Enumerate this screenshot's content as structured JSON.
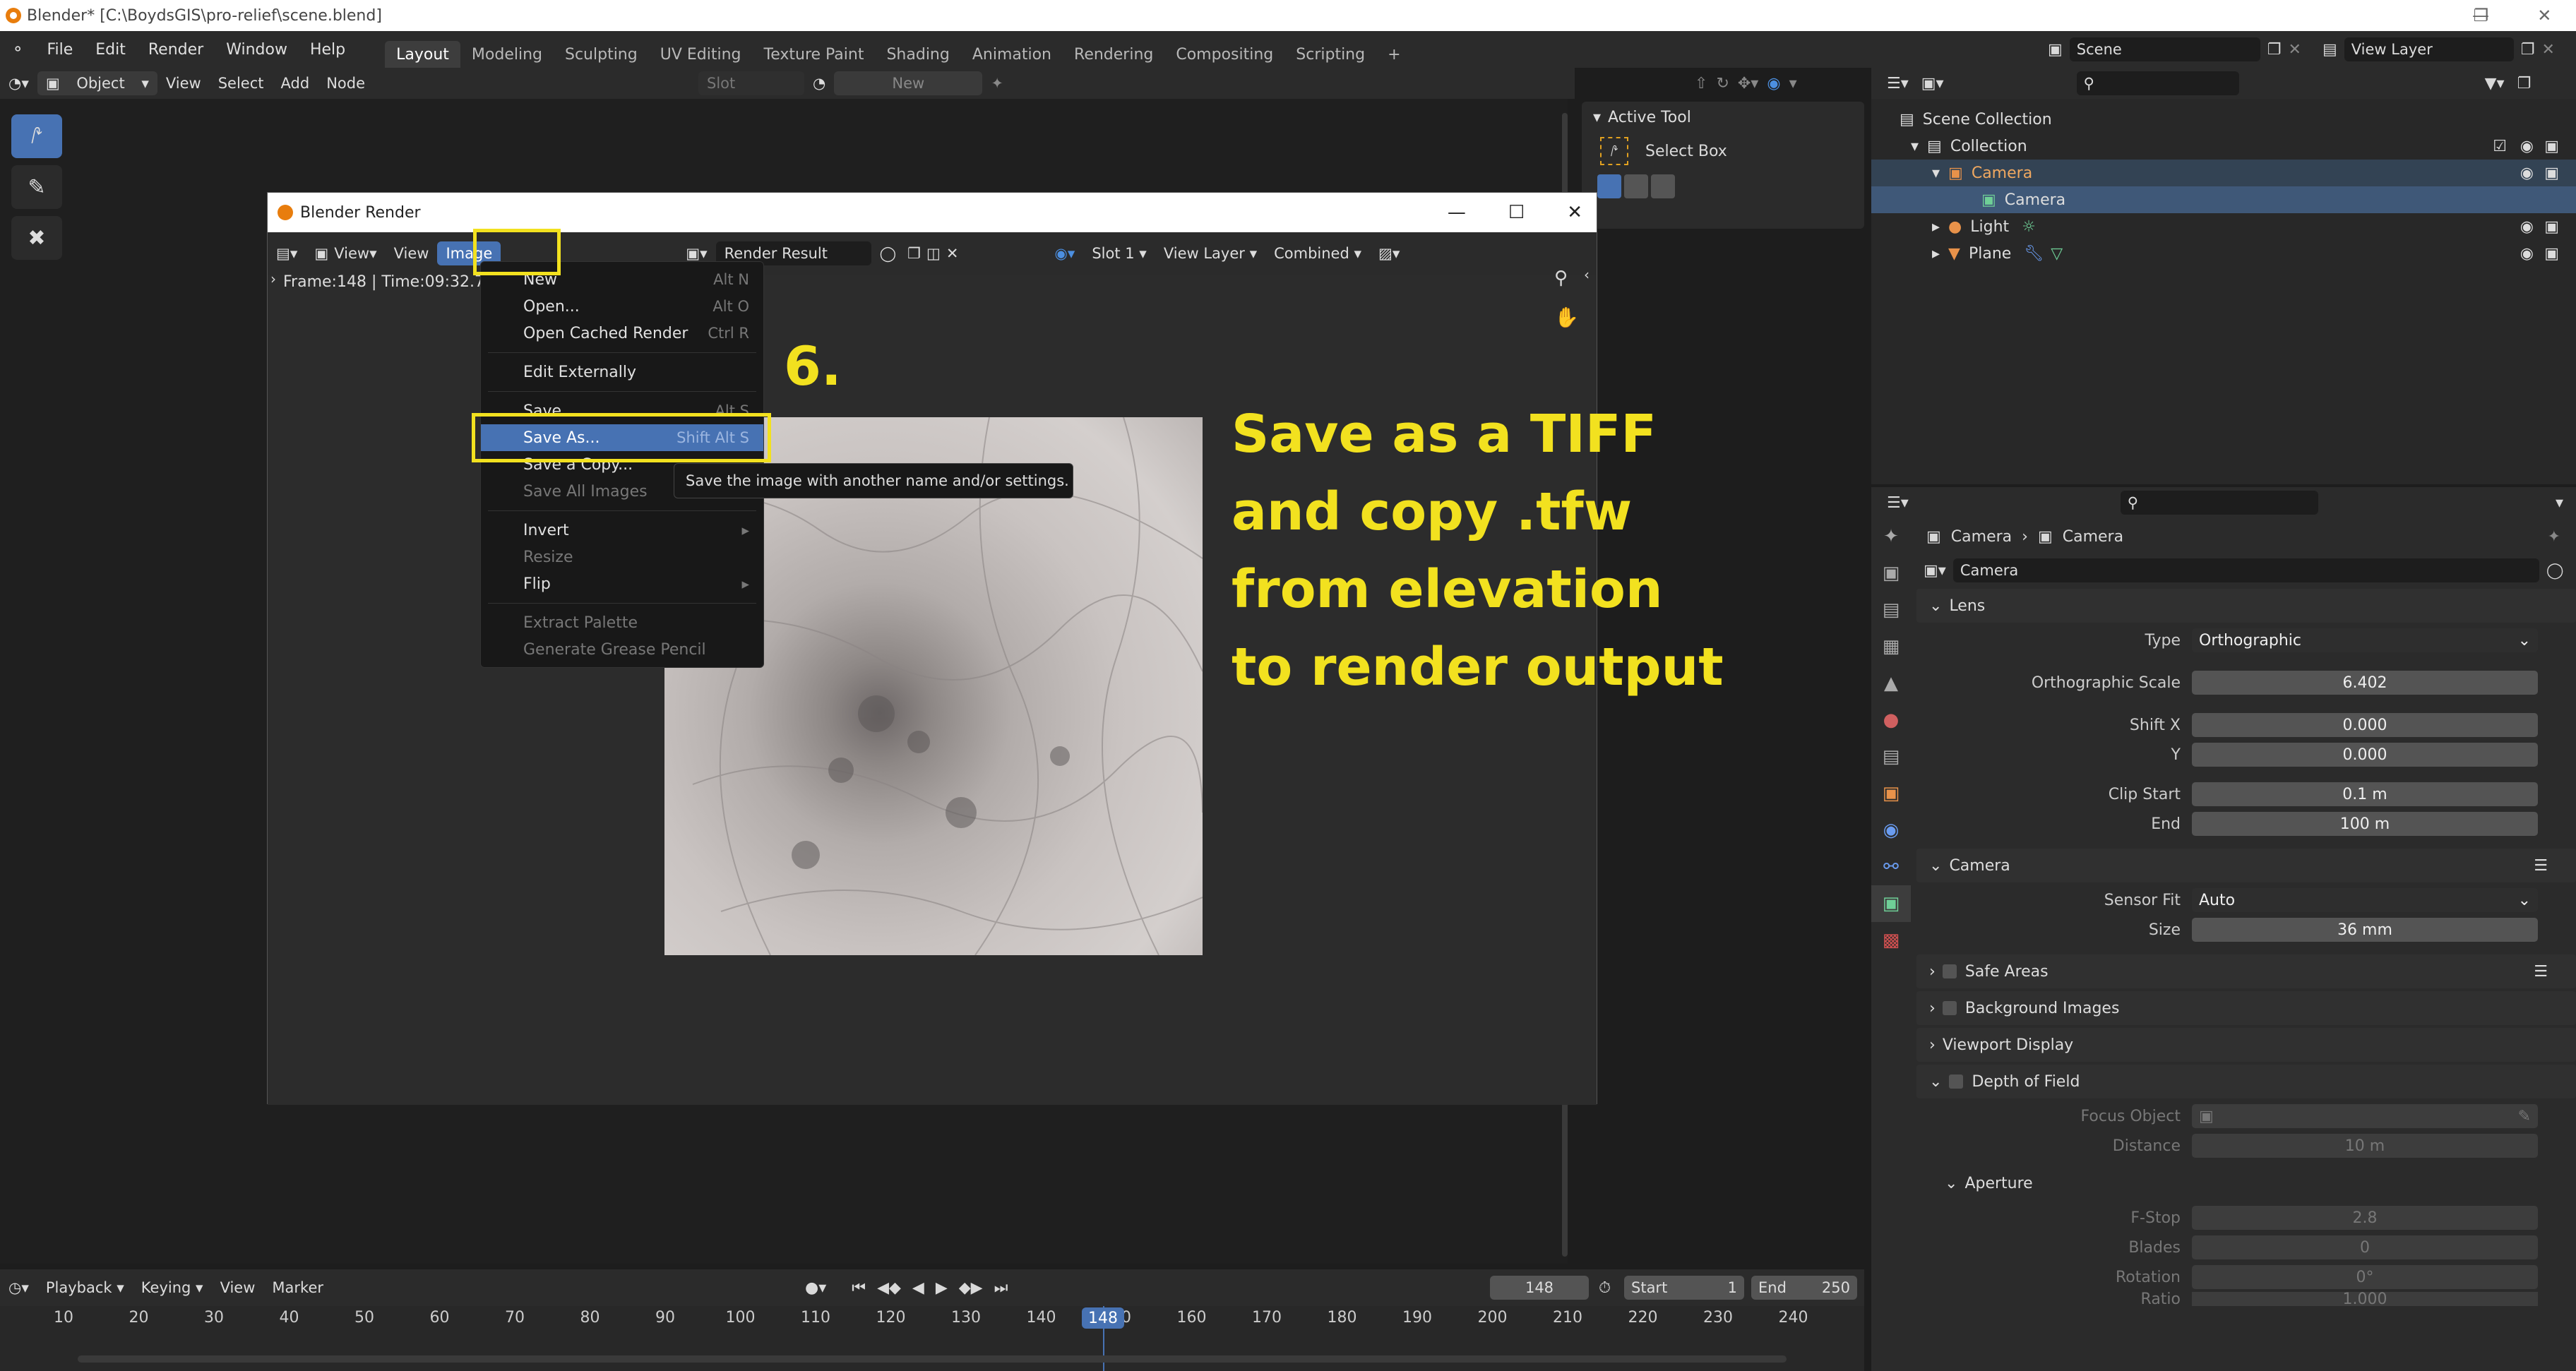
{
  "window": {
    "title": "Blender* [C:\\BoydsGIS\\pro-relief\\scene.blend]"
  },
  "menubar": {
    "items": [
      "File",
      "Edit",
      "Render",
      "Window",
      "Help"
    ]
  },
  "workspaces": [
    "Layout",
    "Modeling",
    "Sculpting",
    "UV Editing",
    "Texture Paint",
    "Shading",
    "Animation",
    "Rendering",
    "Compositing",
    "Scripting"
  ],
  "active_workspace": "Layout",
  "scene": {
    "label": "Scene",
    "view_layer": "View Layer"
  },
  "viewport_header": {
    "mode": "Object",
    "items": [
      "View",
      "Select",
      "Add",
      "Node"
    ],
    "slot": "Slot",
    "new": "New"
  },
  "active_tool": {
    "title": "Active Tool",
    "tool": "Select Box"
  },
  "render_window": {
    "title": "Blender Render",
    "header_items": [
      "View",
      "View",
      "Image"
    ],
    "image_name": "Render Result",
    "slot": "Slot 1",
    "view_layer": "View Layer",
    "pass": "Combined",
    "frame_info": "Frame:148 | Time:09:32.72"
  },
  "image_menu": {
    "items": [
      {
        "label": "New",
        "shortcut": "Alt N"
      },
      {
        "label": "Open...",
        "shortcut": "Alt O"
      },
      {
        "label": "Open Cached Render",
        "shortcut": "Ctrl R"
      },
      {
        "label": "Edit Externally",
        "shortcut": ""
      },
      {
        "label": "Save",
        "shortcut": "Alt S"
      },
      {
        "label": "Save As...",
        "shortcut": "Shift Alt S"
      },
      {
        "label": "Save a Copy...",
        "shortcut": ""
      },
      {
        "label": "Save All Images",
        "shortcut": ""
      },
      {
        "label": "Invert",
        "shortcut": ""
      },
      {
        "label": "Resize",
        "shortcut": ""
      },
      {
        "label": "Flip",
        "shortcut": ""
      },
      {
        "label": "Extract Palette",
        "shortcut": ""
      },
      {
        "label": "Generate Grease Pencil",
        "shortcut": ""
      }
    ],
    "tooltip": "Save the image with another name and/or settings."
  },
  "annotation": {
    "step": "6.",
    "lines": [
      "Save as a TIFF",
      "and copy .tfw",
      "from elevation",
      "to render output"
    ],
    "color": "#f2e11f"
  },
  "outliner": {
    "root": "Scene Collection",
    "rows": [
      "Collection",
      "Camera",
      "Camera",
      "Light",
      "Plane"
    ]
  },
  "properties": {
    "breadcrumb": [
      "Camera",
      "Camera"
    ],
    "datablock": "Camera",
    "lens": {
      "title": "Lens",
      "type_label": "Type",
      "type_value": "Orthographic",
      "scale_label": "Orthographic Scale",
      "scale_value": "6.402",
      "shiftx_label": "Shift X",
      "shiftx_value": "0.000",
      "y_label": "Y",
      "y_value": "0.000",
      "clipstart_label": "Clip Start",
      "clipstart_value": "0.1 m",
      "end_label": "End",
      "end_value": "100 m"
    },
    "camera": {
      "title": "Camera",
      "sensor_label": "Sensor Fit",
      "sensor_value": "Auto",
      "size_label": "Size",
      "size_value": "36 mm"
    },
    "panels": [
      "Safe Areas",
      "Background Images",
      "Viewport Display",
      "Depth of Field"
    ],
    "dof": {
      "focus_label": "Focus Object",
      "distance_label": "Distance",
      "distance_value": "10 m",
      "aperture": "Aperture",
      "fstop_label": "F-Stop",
      "fstop_value": "2.8",
      "blades_label": "Blades",
      "blades_value": "0",
      "rotation_label": "Rotation",
      "rotation_value": "0°",
      "ratio_label": "Ratio",
      "ratio_value": "1.000"
    }
  },
  "timeline": {
    "items": [
      "Playback",
      "Keying",
      "View",
      "Marker"
    ],
    "current_frame": "148",
    "start_label": "Start",
    "start": "1",
    "end_label": "End",
    "end": "250",
    "ticks": [
      "10",
      "20",
      "30",
      "40",
      "50",
      "60",
      "70",
      "80",
      "90",
      "100",
      "110",
      "120",
      "130",
      "140",
      "150",
      "160",
      "170",
      "180",
      "190",
      "200",
      "210",
      "220",
      "230",
      "240"
    ]
  }
}
